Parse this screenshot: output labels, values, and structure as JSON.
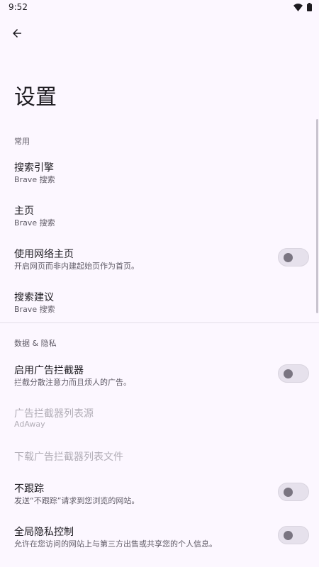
{
  "status": {
    "time": "9:52"
  },
  "header": {
    "title": "设置"
  },
  "sections": {
    "common": "常用",
    "privacy": "数据 & 隐私"
  },
  "items": {
    "search_engine": {
      "title": "搜索引擎",
      "subtitle": "Brave 搜索"
    },
    "homepage": {
      "title": "主页",
      "subtitle": "Brave 搜索"
    },
    "web_homepage": {
      "title": "使用网络主页",
      "subtitle": "开启网页而非内建起始页作为首页。",
      "enabled": false
    },
    "search_suggestions": {
      "title": "搜索建议",
      "subtitle": "Brave 搜索"
    },
    "ad_blocker": {
      "title": "启用广告拦截器",
      "subtitle": "拦截分散注意力而且烦人的广告。",
      "enabled": false
    },
    "ad_blocker_source": {
      "title": "广告拦截器列表源",
      "subtitle": "AdAway"
    },
    "download_list": {
      "title": "下载广告拦截器列表文件"
    },
    "do_not_track": {
      "title": "不跟踪",
      "subtitle": "发送“不跟踪”请求到您浏览的网站。",
      "enabled": false
    },
    "gpc": {
      "title": "全局隐私控制",
      "subtitle": "允许在您访问的网站上与第三方出售或共享您的个人信息。",
      "enabled": false
    }
  },
  "icons": {
    "back": "arrow-left-icon",
    "wifi": "wifi-icon",
    "battery": "battery-icon"
  }
}
